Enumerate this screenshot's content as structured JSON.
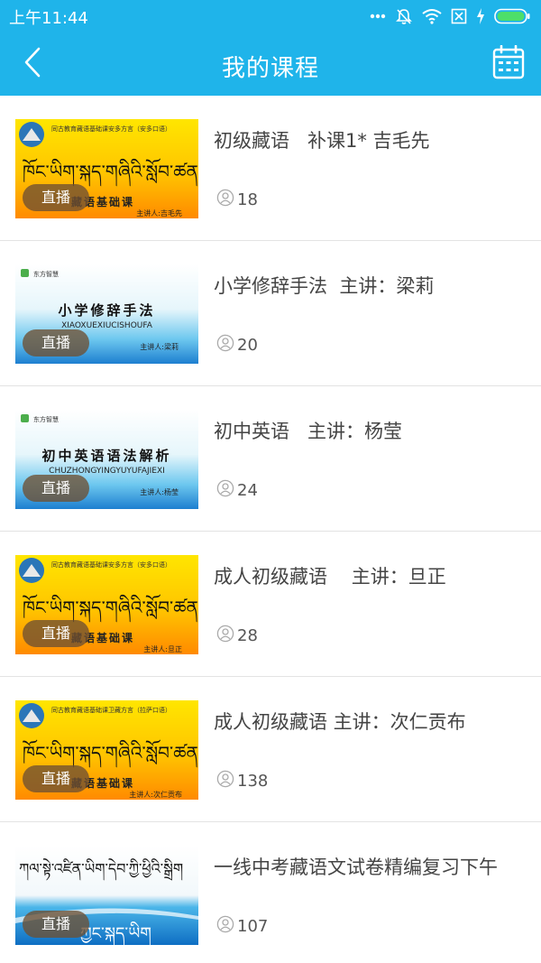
{
  "status_bar": {
    "time": "上午11:44",
    "icons": [
      "more-dots-icon",
      "mute-icon",
      "wifi-icon",
      "sim-off-icon",
      "charging-icon",
      "battery-icon"
    ]
  },
  "app_bar": {
    "title": "我的课程",
    "back_icon": "chevron-left-icon",
    "calendar_icon": "calendar-icon",
    "background": "#1fb4ea"
  },
  "live_badge": "直播",
  "courses": [
    {
      "title": "初级藏语   补课1* 吉毛先",
      "students": "18",
      "thumbnail": {
        "style": "tibetan-yellow",
        "header": "同古教育藏语基础课安多方言（安多口语）",
        "tibetan": "ཁོང་ཡིག་སྐད་གཞིའི་སློབ་ཚན།",
        "subtitle": "藏语基础课",
        "lecturer": "主讲人:吉毛先"
      }
    },
    {
      "title": "小学修辞手法  主讲：梁莉",
      "students": "20",
      "thumbnail": {
        "style": "blue-gradient",
        "brand": "东方智慧",
        "title": "小学修辞手法",
        "pinyin": "XIAOXUEXIUCISHOUFA",
        "lecturer": "主讲人:梁莉"
      }
    },
    {
      "title": "初中英语   主讲：杨莹",
      "students": "24",
      "thumbnail": {
        "style": "blue-gradient",
        "brand": "东方智慧",
        "title": "初中英语语法解析",
        "pinyin": "CHUZHONGYINGYUYUFAJIEXI",
        "lecturer": "主讲人:杨莹"
      }
    },
    {
      "title": "成人初级藏语    主讲：旦正",
      "students": "28",
      "thumbnail": {
        "style": "tibetan-yellow",
        "header": "同古教育藏语基础课安多方言（安多口语）",
        "tibetan": "ཁོང་ཡིག་སྐད་གཞིའི་སློབ་ཚན།",
        "subtitle": "藏语基础课",
        "lecturer": "主讲人:旦正"
      }
    },
    {
      "title": "成人初级藏语 主讲：次仁贡布",
      "students": "138",
      "thumbnail": {
        "style": "tibetan-yellow",
        "header": "同古教育藏语基础课卫藏方言（拉萨口语）",
        "tibetan": "ཁོང་ཡིག་སྐད་གཞིའི་སློབ་ཚན།",
        "subtitle": "藏语基础课",
        "lecturer": "主讲人:次仁贡布"
      }
    },
    {
      "title": "一线中考藏语文试卷精编复习下午",
      "students": "107",
      "thumbnail": {
        "style": "tibetan-blue",
        "tibetan_top": "ཀལ་སྟེ་འཛིན་ཡིག་དེབ་ཀྱི་ཕྱིའི་སྒྲིག",
        "tibetan": "ཀྱང་སྐད་ཡིག"
      }
    }
  ]
}
